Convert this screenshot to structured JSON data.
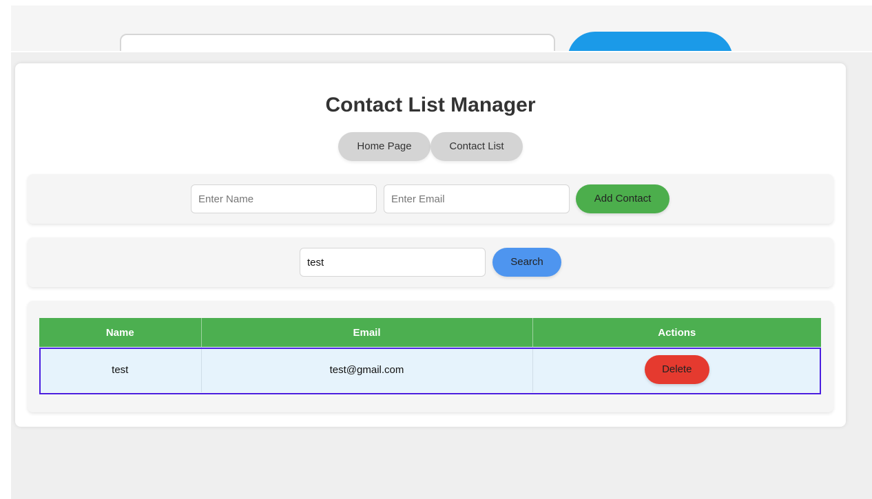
{
  "app": {
    "title": "Contact List Manager"
  },
  "nav": {
    "items": [
      {
        "label": "Home Page"
      },
      {
        "label": "Contact List"
      }
    ]
  },
  "add_form": {
    "name_placeholder": "Enter Name",
    "name_value": "",
    "email_placeholder": "Enter Email",
    "email_value": "",
    "add_label": "Add Contact"
  },
  "search": {
    "value": "test",
    "button_label": "Search"
  },
  "table": {
    "headers": [
      "Name",
      "Email",
      "Actions"
    ],
    "rows": [
      {
        "name": "test",
        "email": "test@gmail.com",
        "action_label": "Delete"
      }
    ]
  },
  "colors": {
    "header_green": "#4caf50",
    "add_green": "#4cae4c",
    "search_blue": "#4e95ef",
    "delete_red": "#e53a2f",
    "row_bg": "#e6f3fc",
    "selection_outline": "#4a1ee0",
    "background_button_blue": "#1b9ae8"
  }
}
